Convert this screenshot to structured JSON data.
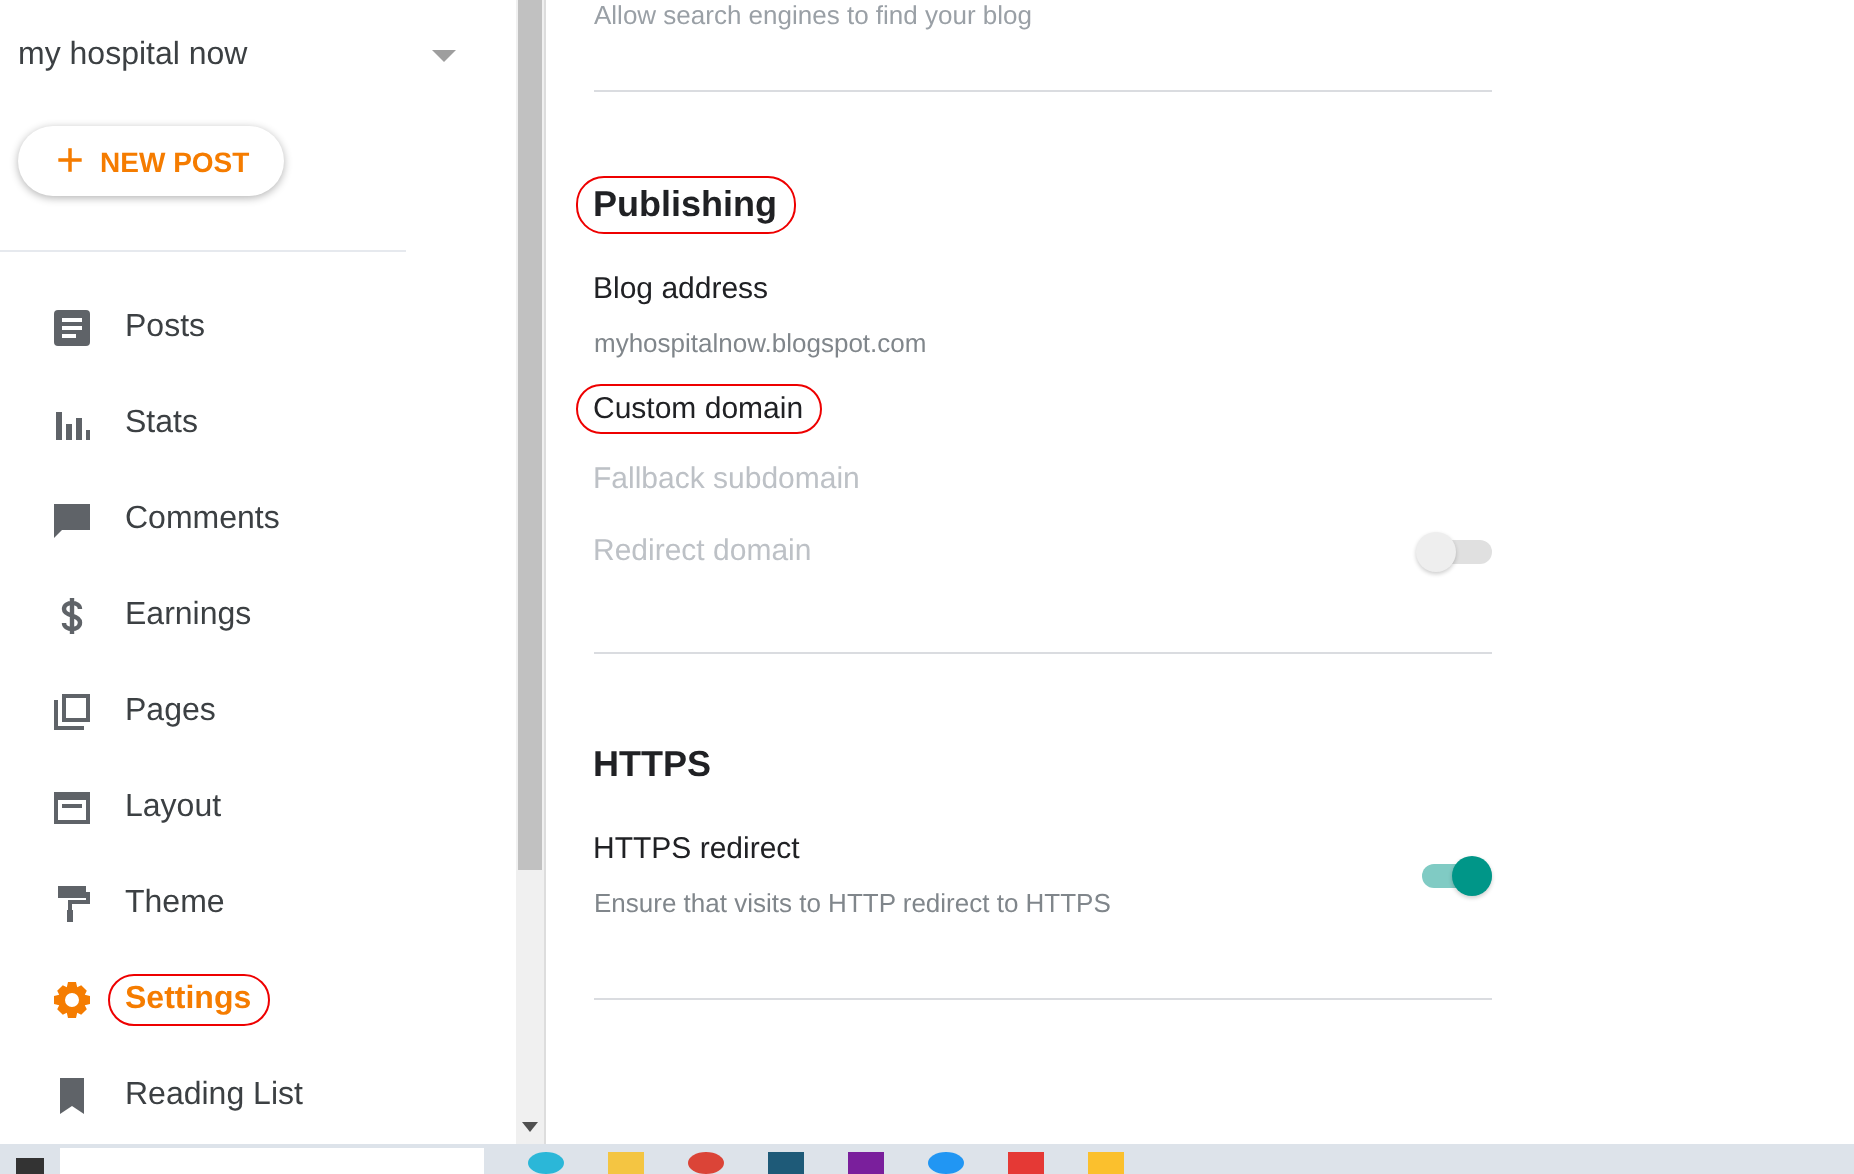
{
  "sidebar": {
    "blog_name": "my hospital now",
    "new_post_button": {
      "icon": "+",
      "label": "NEW POST"
    },
    "items": [
      {
        "label": "Posts",
        "selected": false,
        "circled": false
      },
      {
        "label": "Stats",
        "selected": false,
        "circled": false
      },
      {
        "label": "Comments",
        "selected": false,
        "circled": false
      },
      {
        "label": "Earnings",
        "selected": false,
        "circled": false
      },
      {
        "label": "Pages",
        "selected": false,
        "circled": false
      },
      {
        "label": "Layout",
        "selected": false,
        "circled": false
      },
      {
        "label": "Theme",
        "selected": false,
        "circled": false
      },
      {
        "label": "Settings",
        "selected": true,
        "circled": true
      },
      {
        "label": "Reading List",
        "selected": false,
        "circled": false
      }
    ]
  },
  "settings": {
    "top_description": "Allow search engines to find your blog",
    "sections": [
      {
        "title": "Publishing",
        "circled": true,
        "rows": [
          {
            "label": "Blog address",
            "description": "myhospitalnow.blogspot.com",
            "disabled": false,
            "circled": false
          },
          {
            "label": "Custom domain",
            "disabled": false,
            "circled": true
          },
          {
            "label": "Fallback subdomain",
            "disabled": true,
            "circled": false
          },
          {
            "label": "Redirect domain",
            "disabled": true,
            "circled": false,
            "toggle": {
              "on": false
            }
          }
        ]
      },
      {
        "title": "HTTPS",
        "circled": false,
        "rows": [
          {
            "label": "HTTPS redirect",
            "description": "Ensure that visits to HTTP redirect to HTTPS",
            "disabled": false,
            "circled": false,
            "toggle": {
              "on": true
            }
          }
        ]
      }
    ]
  }
}
